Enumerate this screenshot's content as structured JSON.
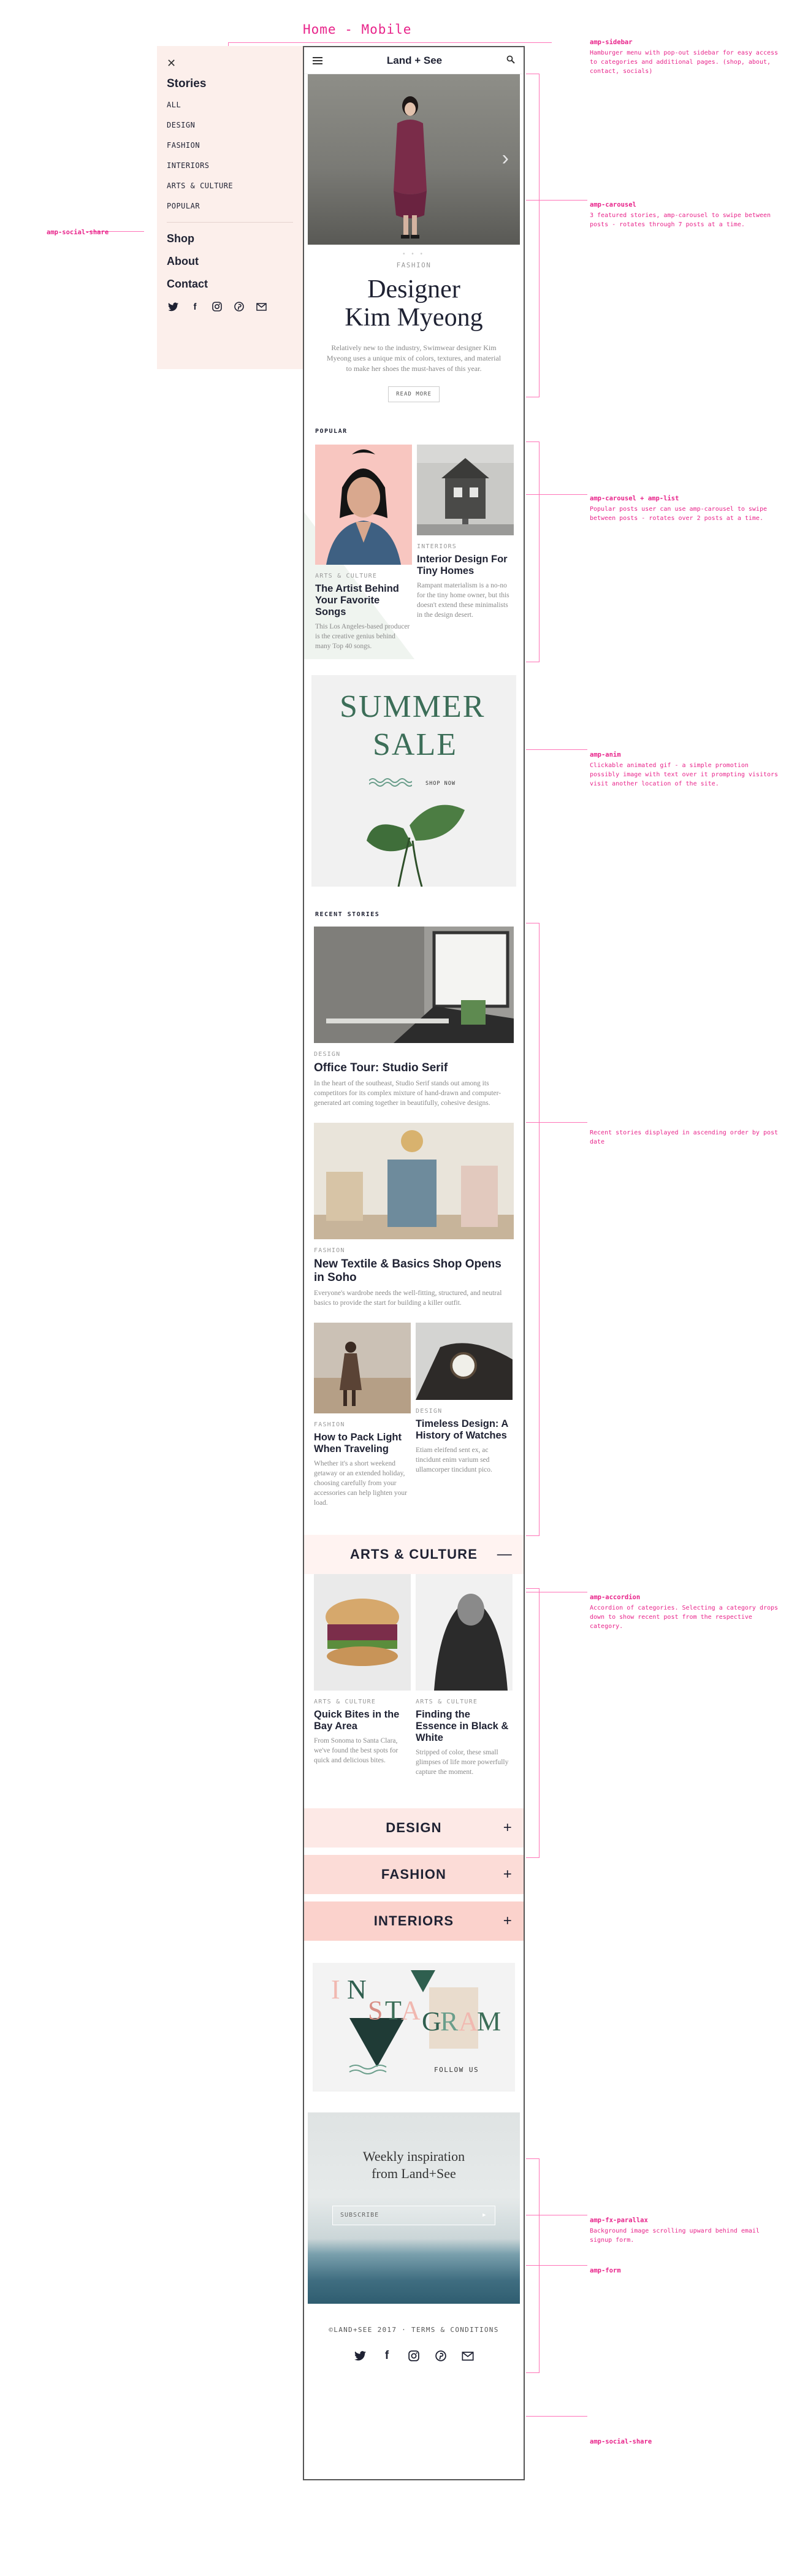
{
  "page": {
    "label": "Home - Mobile"
  },
  "annotations": {
    "sidebar": {
      "title": "amp-sidebar",
      "text": "Hamburger menu with pop-out sidebar for easy access to categories and additional pages. (shop, about, contact, socials)"
    },
    "carousel": {
      "title": "amp-carousel",
      "text": "3 featured stories, amp-carousel to swipe between posts - rotates through 7 posts at a time."
    },
    "carousel_list": {
      "title": "amp-carousel + amp-list",
      "text": "Popular posts user can use amp-carousel to swipe between posts - rotates over 2 posts at a time."
    },
    "anim": {
      "title": "amp-anim",
      "text": "Clickable animated gif - a simple promotion possibly image with text over it prompting visitors visit another location of the site."
    },
    "recent": {
      "title": "",
      "text": "Recent stories displayed in ascending order by post date"
    },
    "accordion": {
      "title": "amp-accordion",
      "text": "Accordion of categories. Selecting a category drops down to show recent post from the respective category."
    },
    "parallax": {
      "title": "amp-fx-parallax",
      "text": "Background image scrolling upward behind email signup form."
    },
    "form": {
      "title": "amp-form",
      "text": ""
    },
    "social_share": {
      "title": "amp-social-share",
      "text": ""
    },
    "social_share_left": {
      "title": "amp-social-share"
    }
  },
  "sidebar": {
    "close": "✕",
    "heading": "Stories",
    "categories": [
      "ALL",
      "DESIGN",
      "FASHION",
      "INTERIORS",
      "ARTS & CULTURE",
      "POPULAR"
    ],
    "links": [
      "Shop",
      "About",
      "Contact"
    ],
    "social_icons": [
      "twitter-icon",
      "facebook-icon",
      "instagram-icon",
      "pinterest-icon",
      "email-icon"
    ]
  },
  "header": {
    "brand": "Land + See"
  },
  "hero": {
    "category": "FASHION",
    "title_line1": "Designer",
    "title_line2": "Kim Myeong",
    "text": "Relatively new to the industry, Swimwear designer Kim Myeong uses a unique mix of colors, textures, and material to make her shoes the must-haves of this year.",
    "button": "READ MORE",
    "dots": "• • •"
  },
  "popular": {
    "label": "POPULAR",
    "items": [
      {
        "category": "ARTS & CULTURE",
        "title": "The Artist Behind Your Favorite Songs",
        "text": "This Los Angeles-based producer is the creative genius behind many Top 40 songs."
      },
      {
        "category": "INTERIORS",
        "title": "Interior Design For Tiny Homes",
        "text": "Rampant materialism is a no-no for the tiny home owner, but this doesn't extend these minimalists in the design desert."
      }
    ]
  },
  "sale": {
    "word1": "SUMMER",
    "word2": "SALE",
    "cta": "SHOP NOW"
  },
  "recent": {
    "label": "RECENT STORIES",
    "items": [
      {
        "category": "DESIGN",
        "title": "Office Tour: Studio Serif",
        "text": "In the heart of the southeast, Studio Serif stands out among its competitors for its complex mixture of hand-drawn and computer-generated art coming together in beautifully, cohesive designs."
      },
      {
        "category": "FASHION",
        "title": "New Textile & Basics Shop Opens in Soho",
        "text": "Everyone's wardrobe needs the well-fitting, structured, and neutral basics to provide the start for building a killer outfit."
      },
      {
        "category": "FASHION",
        "title": "How to Pack Light When Traveling",
        "text": "Whether it's a short weekend getaway or an extended holiday, choosing carefully from your accessories can help lighten your load."
      },
      {
        "category": "DESIGN",
        "title": "Timeless Design: A History of Watches",
        "text": "Etiam eleifend sent ex, ac tincidunt enim varium sed ullamcorper tincidunt pico."
      }
    ]
  },
  "accordion": {
    "open_title": "ARTS & CULTURE",
    "open_sign": "—",
    "items": [
      {
        "category": "ARTS & CULTURE",
        "title": "Quick Bites in the Bay Area",
        "text": "From Sonoma to Santa Clara, we've found the best spots for quick and delicious bites."
      },
      {
        "category": "ARTS & CULTURE",
        "title": "Finding the Essence in Black & White",
        "text": "Stripped of color, these small glimpses of life more powerfully capture the moment."
      }
    ],
    "closed": [
      {
        "title": "DESIGN",
        "sign": "+"
      },
      {
        "title": "FASHION",
        "sign": "+"
      },
      {
        "title": "INTERIORS",
        "sign": "+"
      }
    ]
  },
  "instagram": {
    "letters": [
      "I",
      "N",
      "S",
      "T",
      "A",
      "G",
      "R",
      "A",
      "M"
    ],
    "follow": "FOLLOW US"
  },
  "signup": {
    "title_line1": "Weekly inspiration",
    "title_line2": "from Land+See",
    "placeholder": "SUBSCRIBE",
    "arrow": "▸"
  },
  "footer": {
    "text": "©LAND+SEE 2017 · TERMS & CONDITIONS"
  },
  "colors": {
    "annotation": "#e8238a",
    "sidebar_bg": "#fcefeb",
    "accent_green": "#3c6e58",
    "accordion_bg": "#fdeae7"
  }
}
